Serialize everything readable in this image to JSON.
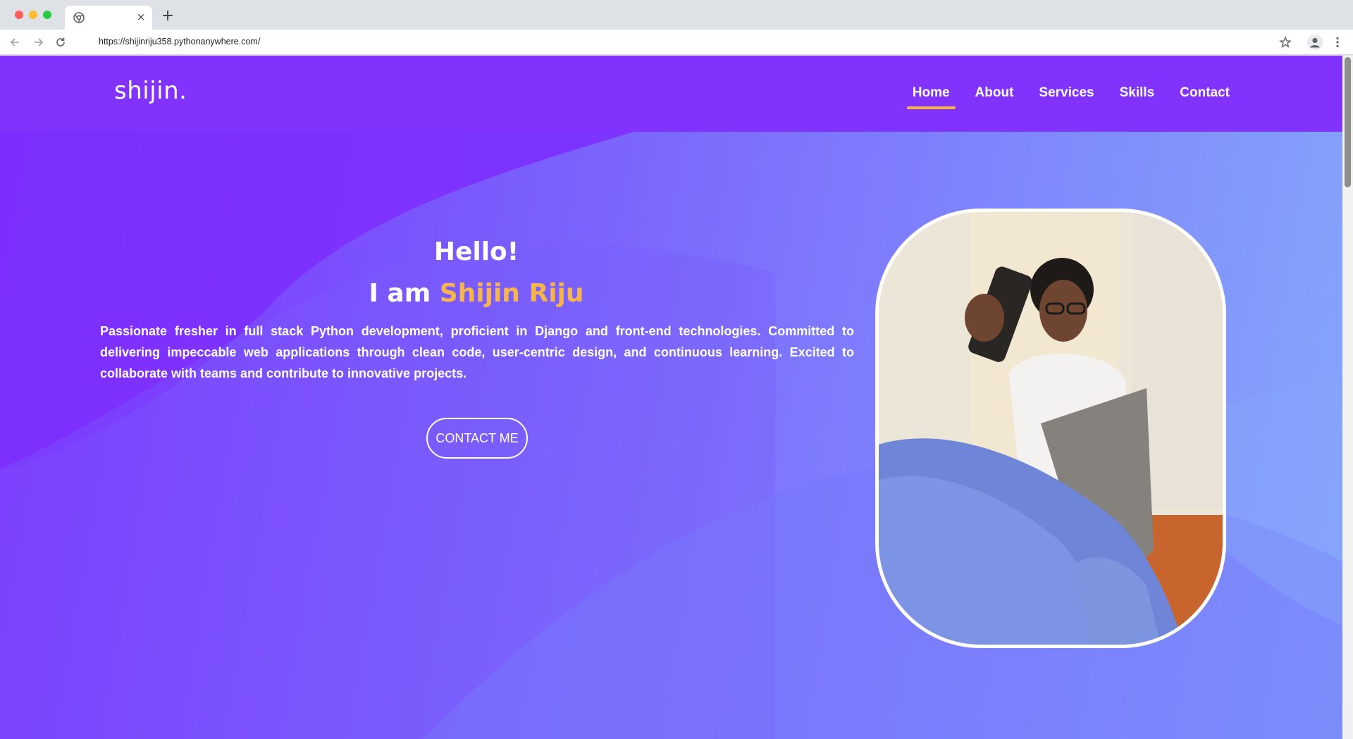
{
  "browser": {
    "url": "https://shijinriju358.pythonanywhere.com/",
    "new_tab_label": "+",
    "tab_close_label": "×"
  },
  "site": {
    "logo": "shijin.",
    "nav": [
      {
        "label": "Home",
        "active": true
      },
      {
        "label": "About",
        "active": false
      },
      {
        "label": "Services",
        "active": false
      },
      {
        "label": "Skills",
        "active": false
      },
      {
        "label": "Contact",
        "active": false
      }
    ]
  },
  "hero": {
    "greeting": "Hello!",
    "intro_prefix": "I am ",
    "name": "Shijin Riju",
    "bio": "Passionate fresher in full stack Python development, proficient in Django and front-end technologies. Committed to delivering impeccable web applications through clean code, user-centric design, and continuous learning. Excited to collaborate with teams and contribute to innovative projects.",
    "cta_label": "CONTACT ME"
  },
  "colors": {
    "header_bg": "#8132fd",
    "accent": "#f6b64d",
    "nav_underline": "#f4b43f"
  }
}
